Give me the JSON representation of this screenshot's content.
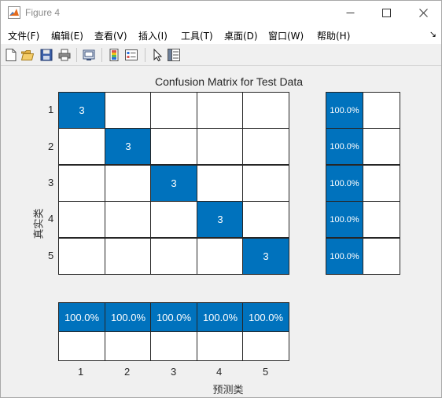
{
  "window": {
    "title": "Figure 4",
    "controls": [
      "minimize-icon",
      "maximize-icon",
      "close-icon"
    ]
  },
  "menubar": {
    "items": [
      {
        "label": "文件(F)"
      },
      {
        "label": "编辑(E)"
      },
      {
        "label": "查看(V)"
      },
      {
        "label": "插入(I)"
      },
      {
        "label": "工具(T)"
      },
      {
        "label": "桌面(D)"
      },
      {
        "label": "窗口(W)"
      },
      {
        "label": "帮助(H)"
      }
    ],
    "overflow_icon": "menu-overflow-arrow-icon"
  },
  "toolbar": {
    "icons": [
      "new-figure-icon",
      "open-file-icon",
      "save-icon",
      "print-icon",
      "link-plot-icon",
      "insert-colorbar-icon",
      "insert-legend-icon",
      "edit-plot-pointer-icon",
      "property-inspector-icon"
    ]
  },
  "colors": {
    "highlight": "#0072bd",
    "empty_cell": "#ffffff",
    "grid": "#262626"
  },
  "chart_data": {
    "type": "heatmap",
    "title": "Confusion Matrix for Test Data",
    "xlabel": "预测类",
    "ylabel": "真实类",
    "classes": [
      "1",
      "2",
      "3",
      "4",
      "5"
    ],
    "matrix": [
      [
        "3",
        "",
        "",
        "",
        ""
      ],
      [
        "",
        "3",
        "",
        "",
        ""
      ],
      [
        "",
        "",
        "3",
        "",
        ""
      ],
      [
        "",
        "",
        "",
        "3",
        ""
      ],
      [
        "",
        "",
        "",
        "",
        "3"
      ]
    ],
    "row_summary": [
      [
        "100.0%",
        ""
      ],
      [
        "100.0%",
        ""
      ],
      [
        "100.0%",
        ""
      ],
      [
        "100.0%",
        ""
      ],
      [
        "100.0%",
        ""
      ]
    ],
    "column_summary": [
      [
        "100.0%",
        "100.0%",
        "100.0%",
        "100.0%",
        "100.0%"
      ],
      [
        "",
        "",
        "",
        "",
        ""
      ]
    ]
  }
}
